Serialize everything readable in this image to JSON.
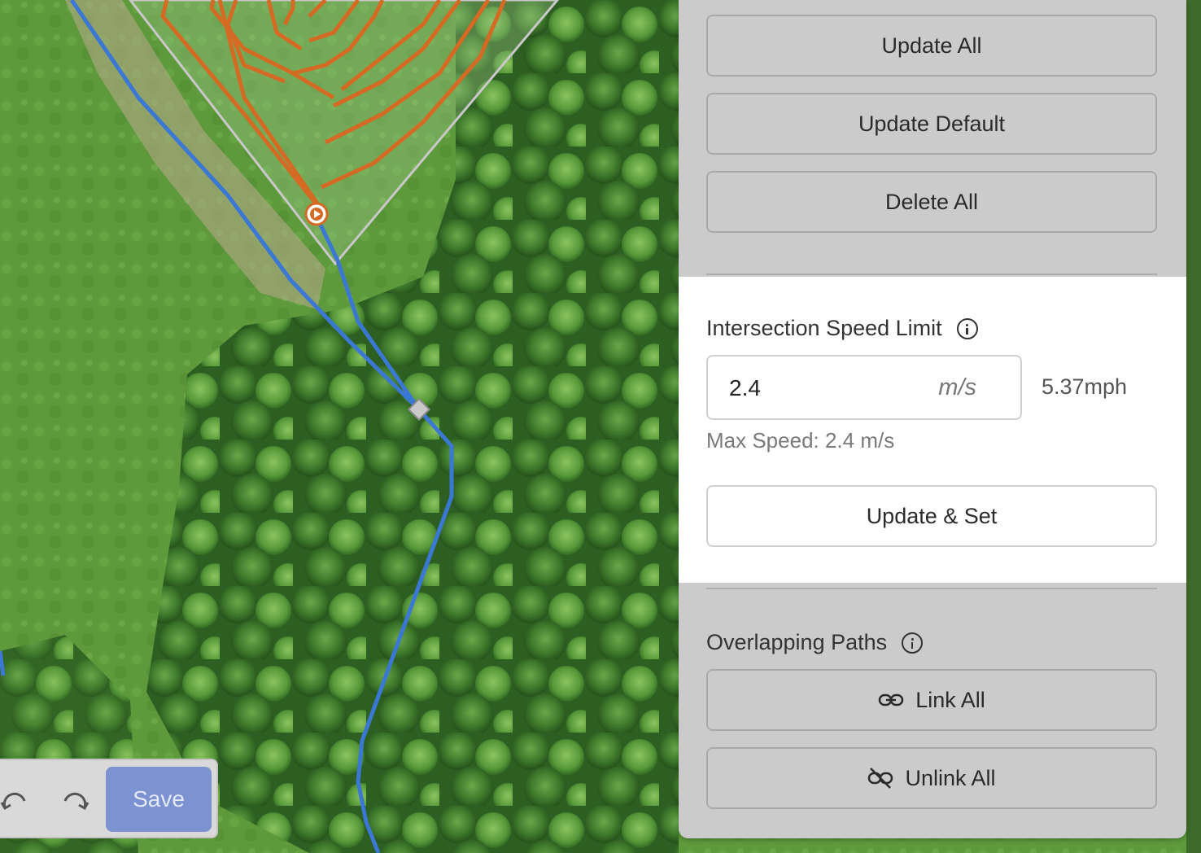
{
  "panel": {
    "buttons_top": {
      "update_all": "Update All",
      "update_default": "Update Default",
      "delete_all": "Delete All"
    },
    "speed_limit": {
      "title": "Intersection Speed Limit",
      "info_icon": "info-icon",
      "value": "2.4",
      "unit": "m/s",
      "converted": "5.37mph",
      "max_speed_text": "Max Speed: 2.4 m/s",
      "update_set_label": "Update & Set"
    },
    "overlapping_paths": {
      "title": "Overlapping Paths",
      "info_icon": "info-icon",
      "link_all_label": "Link All",
      "link_icon": "link-icon",
      "unlink_all_label": "Unlink All",
      "unlink_icon": "unlink-icon"
    }
  },
  "toolbar": {
    "undo_icon": "undo-icon",
    "redo_icon": "redo-icon",
    "save_label": "Save",
    "save_color": "#7d93d1"
  },
  "map": {
    "path_color_blue": "#3b78d4",
    "path_color_orange": "#d46a24",
    "start_marker_icon": "play-marker-icon",
    "waypoint_icon": "diamond-waypoint-icon"
  }
}
